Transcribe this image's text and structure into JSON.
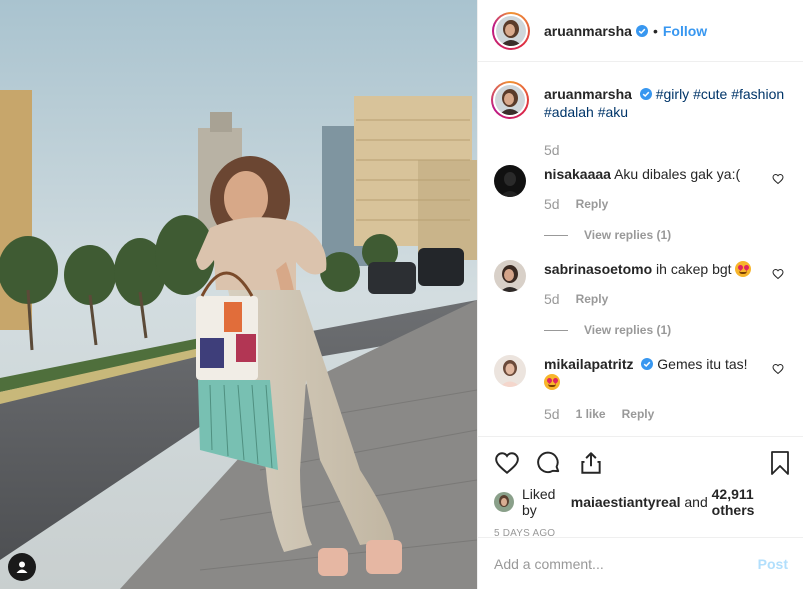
{
  "post": {
    "author": "aruanmarsha",
    "follow_label": "Follow",
    "separator": "•"
  },
  "caption": {
    "username": "aruanmarsha",
    "hashtags": [
      "#girly",
      "#cute",
      "#fashion",
      "#adalah",
      "#aku"
    ],
    "time": "5d"
  },
  "comments": [
    {
      "username": "nisakaaaa",
      "text": "Aku dibales gak ya:(",
      "time": "5d",
      "reply_label": "Reply",
      "view_replies": "View replies (1)"
    },
    {
      "username": "sabrinasoetomo",
      "text": "ih cakep bgt",
      "emoji": "heart-eyes-emoji",
      "time": "5d",
      "reply_label": "Reply",
      "view_replies": "View replies (1)"
    },
    {
      "username": "mikailapatritz",
      "verified": true,
      "text": "Gemes itu tas!",
      "emoji": "heart-eyes-emoji",
      "time": "5d",
      "likes": "1 like",
      "reply_label": "Reply"
    }
  ],
  "likes": {
    "prefix": "Liked by",
    "user": "maiaestiantyreal",
    "conjunction": "and",
    "others": "42,911 others"
  },
  "date": "5 DAYS AGO",
  "add_comment": {
    "placeholder": "Add a comment...",
    "post_label": "Post"
  },
  "colors": {
    "link_blue": "#3897f0",
    "hashtag": "#003569",
    "muted": "#999999",
    "border": "#efefef",
    "verified": "#3897f0"
  },
  "icons": [
    "user-tag-icon",
    "verified-icon",
    "heart-icon",
    "comment-icon",
    "share-icon",
    "bookmark-icon"
  ]
}
